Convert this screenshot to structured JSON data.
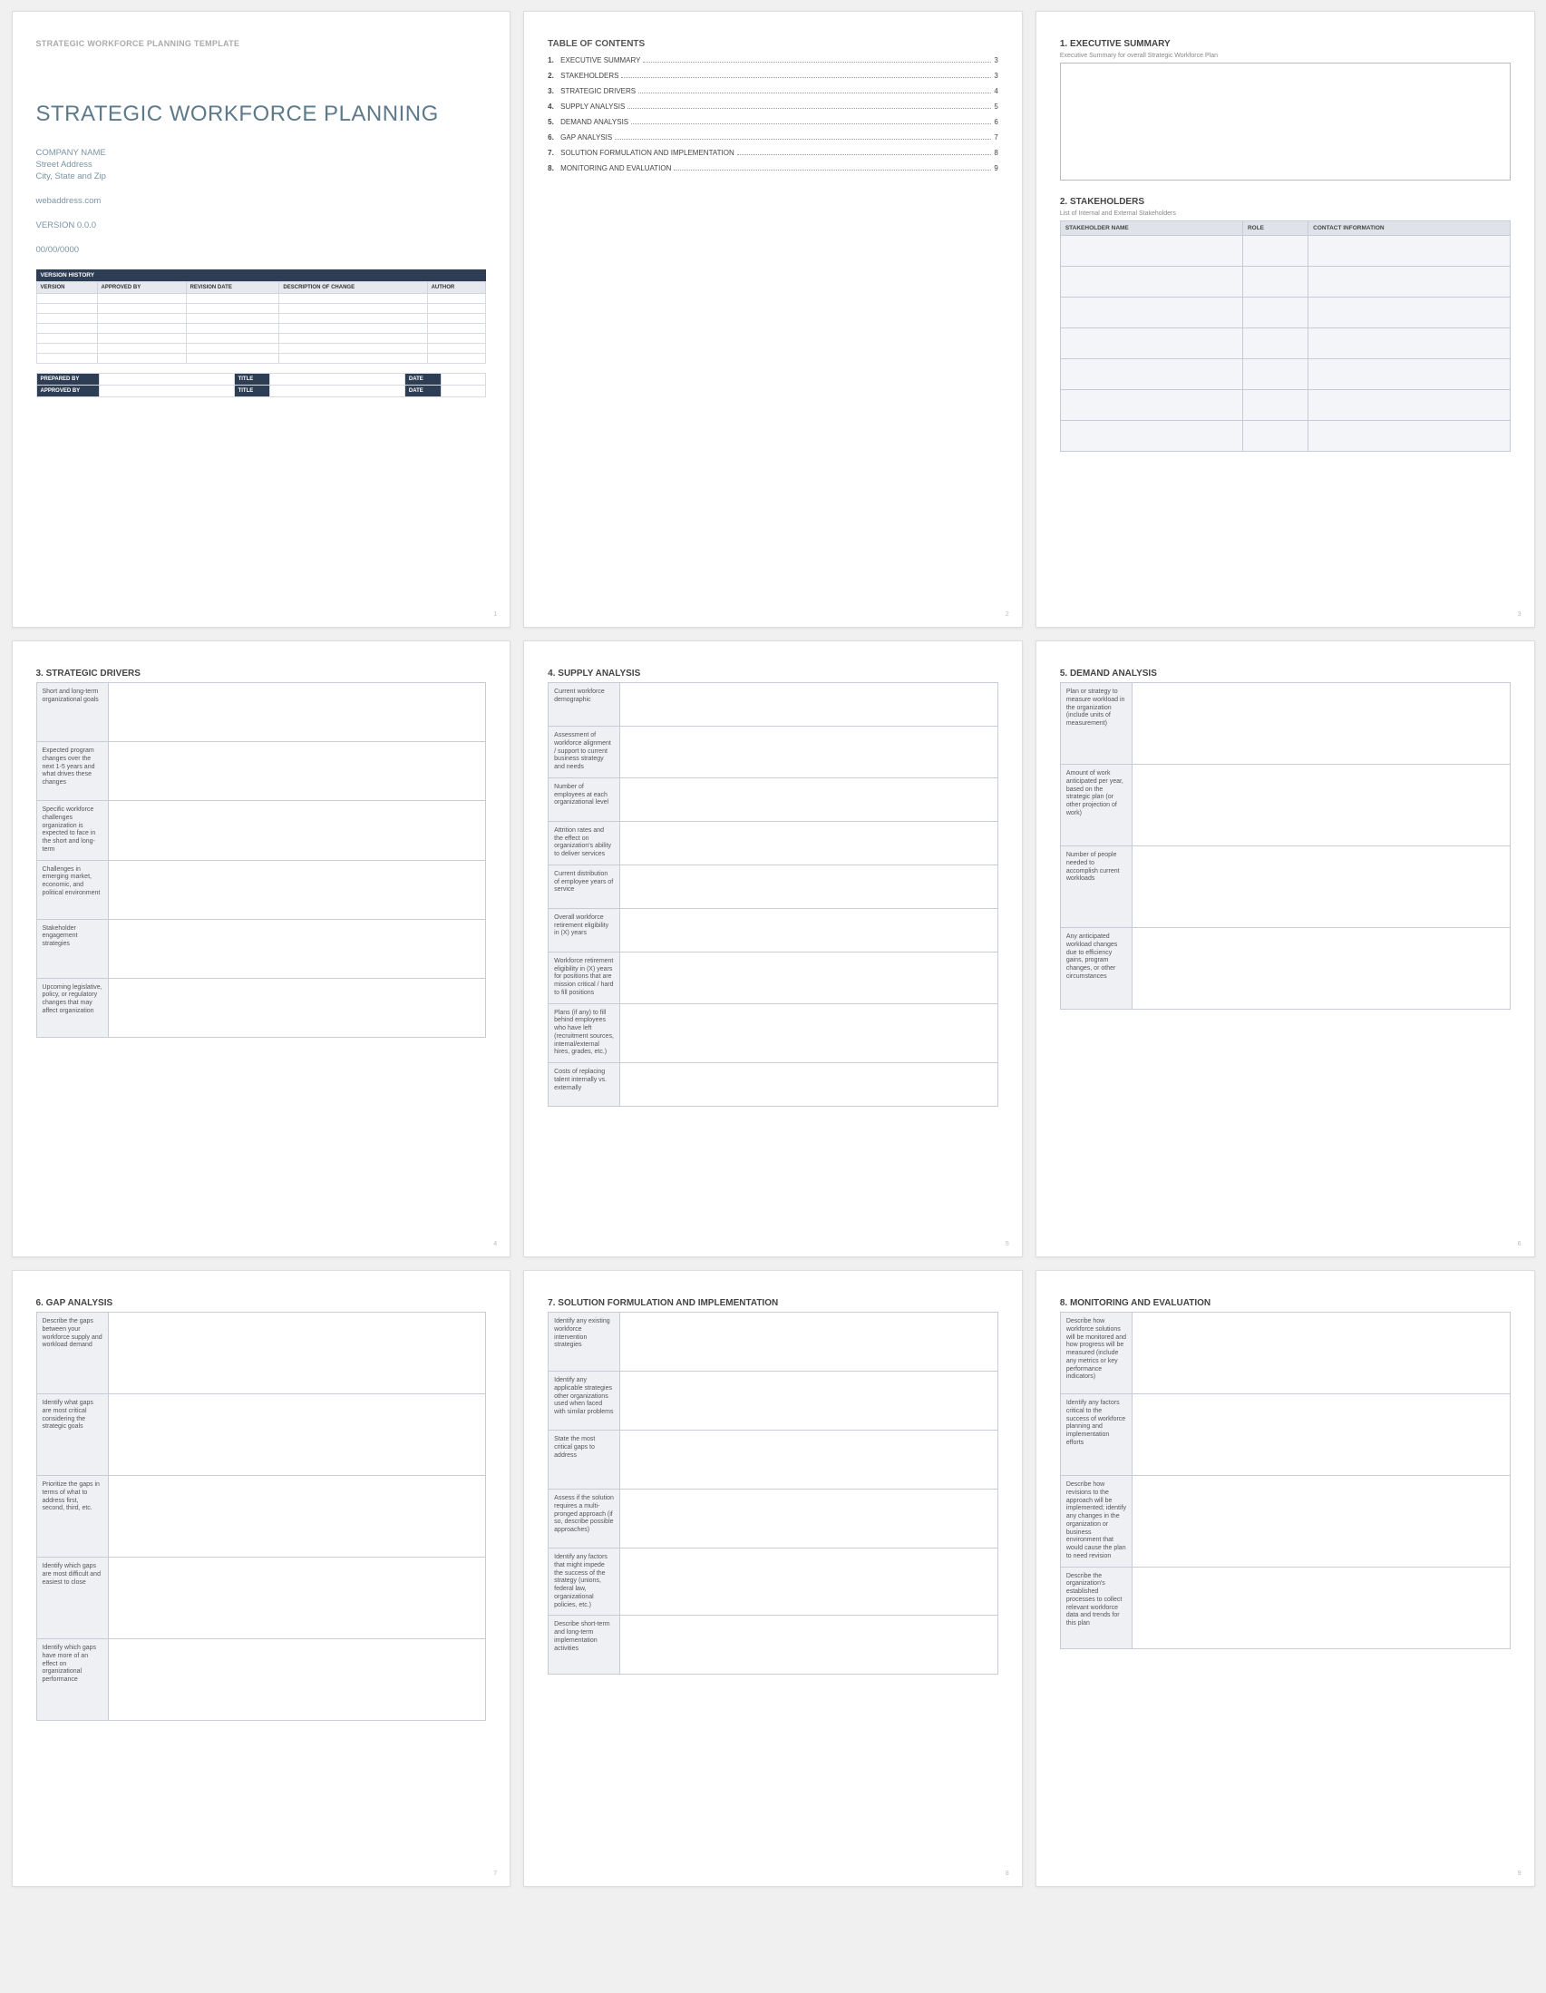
{
  "docType": "STRATEGIC WORKFORCE PLANNING TEMPLATE",
  "title": "STRATEGIC WORKFORCE PLANNING",
  "company": "COMPANY NAME",
  "street": "Street Address",
  "cityState": "City, State and Zip",
  "web": "webaddress.com",
  "version": "VERSION 0.0.0",
  "date": "00/00/0000",
  "vh": {
    "header": "VERSION HISTORY",
    "cols": [
      "VERSION",
      "APPROVED BY",
      "REVISION DATE",
      "DESCRIPTION OF CHANGE",
      "AUTHOR"
    ]
  },
  "sig": {
    "preparedBy": "PREPARED BY",
    "approvedBy": "APPROVED BY",
    "titleLbl": "TITLE",
    "dateLbl": "DATE"
  },
  "tocTitle": "TABLE OF CONTENTS",
  "toc": [
    {
      "n": "1.",
      "name": "EXECUTIVE SUMMARY",
      "pg": "3"
    },
    {
      "n": "2.",
      "name": "STAKEHOLDERS",
      "pg": "3"
    },
    {
      "n": "3.",
      "name": "STRATEGIC DRIVERS",
      "pg": "4"
    },
    {
      "n": "4.",
      "name": "SUPPLY ANALYSIS",
      "pg": "5"
    },
    {
      "n": "5.",
      "name": "DEMAND ANALYSIS",
      "pg": "6"
    },
    {
      "n": "6.",
      "name": "GAP ANALYSIS",
      "pg": "7"
    },
    {
      "n": "7.",
      "name": "SOLUTION FORMULATION AND IMPLEMENTATION",
      "pg": "8"
    },
    {
      "n": "8.",
      "name": "MONITORING AND EVALUATION",
      "pg": "9"
    }
  ],
  "p3": {
    "h1": "1. EXECUTIVE SUMMARY",
    "sub1": "Executive Summary for overall Strategic Workforce Plan",
    "h2": "2. STAKEHOLDERS",
    "sub2": "List of Internal and External Stakeholders",
    "cols": [
      "STAKEHOLDER NAME",
      "ROLE",
      "CONTACT INFORMATION"
    ]
  },
  "p4": {
    "h": "3. STRATEGIC DRIVERS",
    "rows": [
      "Short and long-term organizational goals",
      "Expected program changes over the next 1-5 years and what drives these changes",
      "Specific workforce challenges organization is expected to face in the short and long-term",
      "Challenges in emerging market, economic, and political environment",
      "Stakeholder engagement strategies",
      "Upcoming legislative, policy, or regulatory changes that may affect organization"
    ]
  },
  "p5": {
    "h": "4. SUPPLY ANALYSIS",
    "rows": [
      "Current workforce demographic",
      "Assessment of workforce alignment / support to current business strategy and needs",
      "Number of employees at each organizational level",
      "Attrition rates and the effect on organization's ability to deliver services",
      "Current distribution of employee years of service",
      "Overall workforce retirement eligibility in (X) years",
      "Workforce retirement eligibility in (X) years for positions that are mission critical / hard to fill positions",
      "Plans (if any) to fill behind employees who have left (recruitment sources, internal/external hires, grades, etc.)",
      "Costs of replacing talent internally vs. externally"
    ]
  },
  "p6": {
    "h": "5. DEMAND ANALYSIS",
    "rows": [
      "Plan or strategy to measure workload in the organization (include units of measurement)",
      "Amount of work anticipated per year, based on the strategic plan (or other projection of work)",
      "Number of people needed to accomplish current workloads",
      "Any anticipated workload changes due to efficiency gains, program changes, or other circumstances"
    ]
  },
  "p7": {
    "h": "6. GAP ANALYSIS",
    "rows": [
      "Describe the gaps between your workforce supply and workload demand",
      "Identify what gaps are most critical considering the strategic goals",
      "Prioritize the gaps in terms of what to address first, second, third, etc.",
      "Identify which gaps are most difficult and easiest to close",
      "Identify which gaps have more of an effect on organizational performance"
    ]
  },
  "p8": {
    "h": "7. SOLUTION FORMULATION AND IMPLEMENTATION",
    "rows": [
      "Identify any existing workforce intervention strategies",
      "Identify any applicable strategies other organizations used when faced with similar problems",
      "State the most critical gaps to address",
      "Assess if the solution requires a multi-pronged approach (if so, describe possible approaches)",
      "Identify any factors that might impede the success of the strategy (unions, federal law, organizational policies, etc.)",
      "Describe short-term and long-term implementation activities"
    ]
  },
  "p9": {
    "h": "8. MONITORING AND EVALUATION",
    "rows": [
      "Describe how workforce solutions will be monitored and how progress will be measured (include any metrics or key performance indicators)",
      "Identify any factors critical to the success of workforce planning and implementation efforts",
      "Describe how revisions to the approach will be implemented; identify any changes in the organization or business environment that would cause the plan to need revision",
      "Describe the organization's established processes to collect relevant workforce data and trends for this plan"
    ]
  },
  "pages": [
    "1",
    "2",
    "3",
    "4",
    "5",
    "6",
    "7",
    "8",
    "9"
  ]
}
